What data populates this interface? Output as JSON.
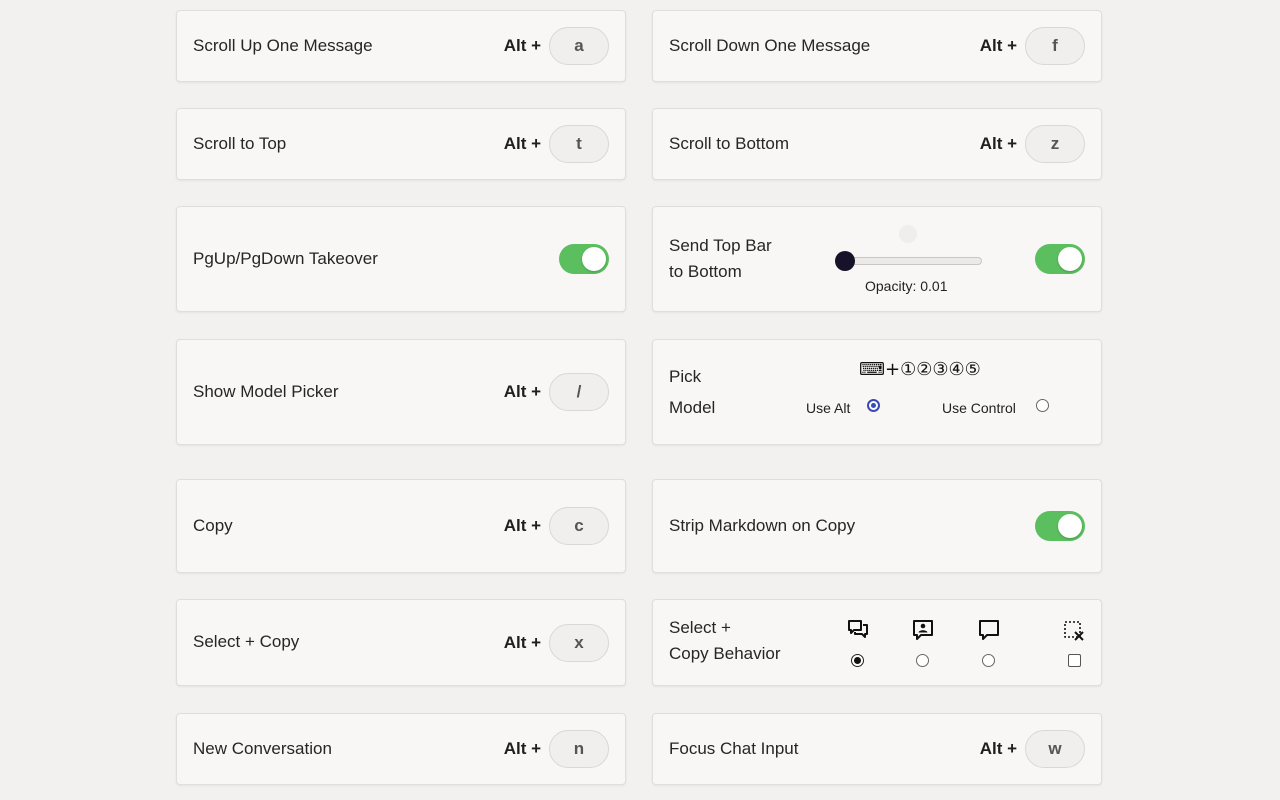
{
  "shortcuts": {
    "modifier": "Alt +",
    "scroll_up": {
      "label": "Scroll Up One Message",
      "key": "a"
    },
    "scroll_down": {
      "label": "Scroll Down One Message",
      "key": "f"
    },
    "scroll_top": {
      "label": "Scroll to Top",
      "key": "t"
    },
    "scroll_bottom": {
      "label": "Scroll to Bottom",
      "key": "z"
    },
    "pgup_takeover": {
      "label": "PgUp/PgDown Takeover",
      "enabled": true
    },
    "send_top_bar": {
      "label_line1": "Send Top Bar",
      "label_line2": "to Bottom",
      "opacity_label": "Opacity: 0.01",
      "opacity_value": 0.01,
      "enabled": true
    },
    "model_picker": {
      "label": "Show Model Picker",
      "key": "/"
    },
    "pick_model": {
      "label_line1": "Pick",
      "label_line2": "Model",
      "hint": "⌨+①②③④⑤",
      "use_alt": "Use Alt",
      "use_control": "Use Control",
      "selected": "Use Alt"
    },
    "copy": {
      "label": "Copy",
      "key": "c"
    },
    "strip_markdown": {
      "label": "Strip Markdown on Copy",
      "enabled": true
    },
    "select_copy": {
      "label": "Select + Copy",
      "key": "x"
    },
    "select_copy_behavior": {
      "label_line1": "Select +",
      "label_line2": "Copy Behavior",
      "options": [
        "conversation-icon",
        "user-message-icon",
        "message-icon",
        "disable-icon"
      ],
      "selected_index": 0
    },
    "new_conversation": {
      "label": "New Conversation",
      "key": "n"
    },
    "focus_input": {
      "label": "Focus Chat Input",
      "key": "w"
    }
  }
}
